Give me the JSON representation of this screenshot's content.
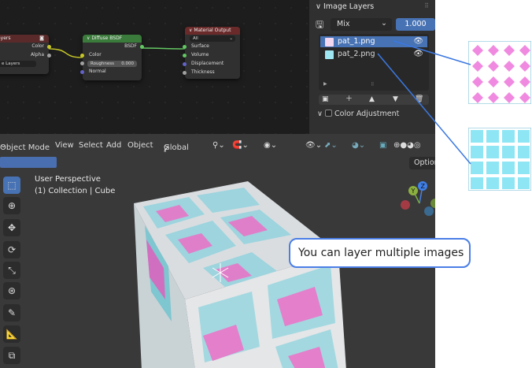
{
  "node_editor": {
    "node_image": {
      "title": "ayers",
      "outputs": [
        "Color",
        "Alpha"
      ],
      "field": "e Layers"
    },
    "node_bsdf": {
      "title": "Diffuse BSDF",
      "output": "BSDF",
      "inputs": [
        "Color",
        "Normal"
      ],
      "roughness_label": "Roughness",
      "roughness_value": "0.000"
    },
    "node_output": {
      "title": "Material Output",
      "target": "All",
      "inputs": [
        "Surface",
        "Volume",
        "Displacement",
        "Thickness"
      ]
    }
  },
  "image_layers_panel": {
    "title": "Image Layers",
    "blend_mode": "Mix",
    "opacity": "1.000",
    "layers": [
      {
        "name": "pat_1.png",
        "active": true
      },
      {
        "name": "pat_2.png",
        "active": false
      }
    ],
    "color_adjustment_label": "Color Adjustment"
  },
  "viewport": {
    "header": {
      "mode": "Object Mode",
      "menu": [
        "View",
        "Select",
        "Add",
        "Object"
      ],
      "orientation": "Global",
      "options": "Options"
    },
    "overlay_line1": "User Perspective",
    "overlay_line2": "(1) Collection | Cube",
    "gizmo_z": "Z",
    "gizmo_y": "Y"
  },
  "callout": {
    "text": "You can layer multiple images"
  },
  "colors": {
    "accent": "#4772b3",
    "pattern_pink": "#f08ae0",
    "pattern_cyan": "#8ee6f4",
    "callout_border": "#4a7ee6"
  }
}
